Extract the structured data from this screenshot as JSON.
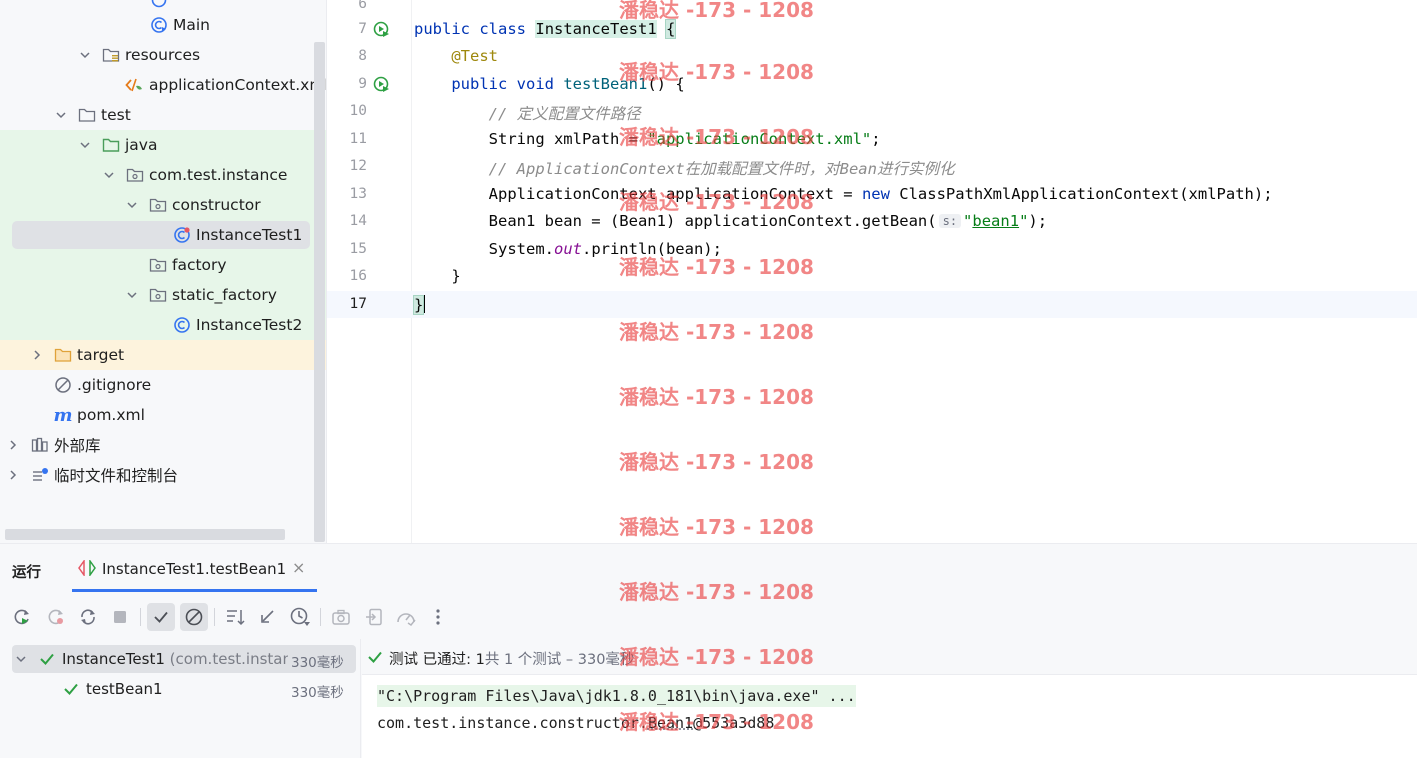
{
  "tree": {
    "items": [
      {
        "label": "Main",
        "icon": "class-main-icon"
      },
      {
        "label": "resources",
        "icon": "resources-folder-icon"
      },
      {
        "label": "applicationContext.xml",
        "icon": "xml-file-icon"
      },
      {
        "label": "test",
        "icon": "folder-icon"
      },
      {
        "label": "java",
        "icon": "test-source-folder-icon"
      },
      {
        "label": "com.test.instance",
        "icon": "package-icon"
      },
      {
        "label": "constructor",
        "icon": "package-icon"
      },
      {
        "label": "InstanceTest1",
        "icon": "test-class-icon"
      },
      {
        "label": "factory",
        "icon": "package-icon"
      },
      {
        "label": "static_factory",
        "icon": "package-icon"
      },
      {
        "label": "InstanceTest2",
        "icon": "class-icon"
      },
      {
        "label": "target",
        "icon": "excluded-folder-icon"
      },
      {
        "label": ".gitignore",
        "icon": "ignored-file-icon"
      },
      {
        "label": "pom.xml",
        "icon": "maven-icon"
      },
      {
        "label": "外部库",
        "icon": "library-icon"
      },
      {
        "label": "临时文件和控制台",
        "icon": "scratch-icon"
      }
    ]
  },
  "editor": {
    "line_numbers": [
      "6",
      "7",
      "8",
      "9",
      "10",
      "11",
      "12",
      "13",
      "14",
      "15",
      "16",
      "17"
    ],
    "code": {
      "l7_kw1": "public",
      "l7_kw2": "class",
      "l7_name": "InstanceTest1",
      "l7_brace": "{",
      "l8_ann": "@Test",
      "l9_kw1": "public",
      "l9_kw2": "void",
      "l9_fn": "testBean1",
      "l9_rest": "() {",
      "l10_cmt": "// 定义配置文件路径",
      "l11_a": "String xmlPath = ",
      "l11_str": "\"applicationContext.xml\"",
      "l11_b": ";",
      "l12_cmt": "// ApplicationContext在加载配置文件时，对Bean进行实例化",
      "l13_a": "ApplicationContext applicationContext = ",
      "l13_kw": "new",
      "l13_b": " ClassPathXmlApplicationContext(xmlPath);",
      "l14_a": "Bean1 bean = (Bean1) applicationContext.getBean(",
      "l14_hint": "s:",
      "l14_q1": "\"",
      "l14_str": "bean1",
      "l14_q2": "\"",
      "l14_b": ");",
      "l15_a": "System.",
      "l15_fld": "out",
      "l15_b": ".println(bean);",
      "l16": "}",
      "l17": "}"
    }
  },
  "watermark": {
    "text": "潘稳达 -173 - 1208"
  },
  "run": {
    "title": "运行",
    "tab_label": "InstanceTest1.testBean1",
    "tab_close": "×",
    "tests": {
      "root_label": "InstanceTest1",
      "root_pkg": "(com.test.instanc",
      "root_time": "330毫秒",
      "child_label": "testBean1",
      "child_time": "330毫秒"
    },
    "status": {
      "prefix": "测试 ",
      "passed": "已通过: 1",
      "summary": "共 1 个测试 – 330毫秒"
    },
    "console": {
      "line1": "\"C:\\Program Files\\Java\\jdk1.8.0_181\\bin\\java.exe\" ...",
      "line2_a": "com.test.instance.constructor.",
      "line2_b": "Bean1",
      "line2_c": "@553a3d88"
    }
  },
  "colors": {
    "accent": "#3574f0",
    "pass_green": "#2ea043",
    "watermark": "#e83c3c"
  }
}
